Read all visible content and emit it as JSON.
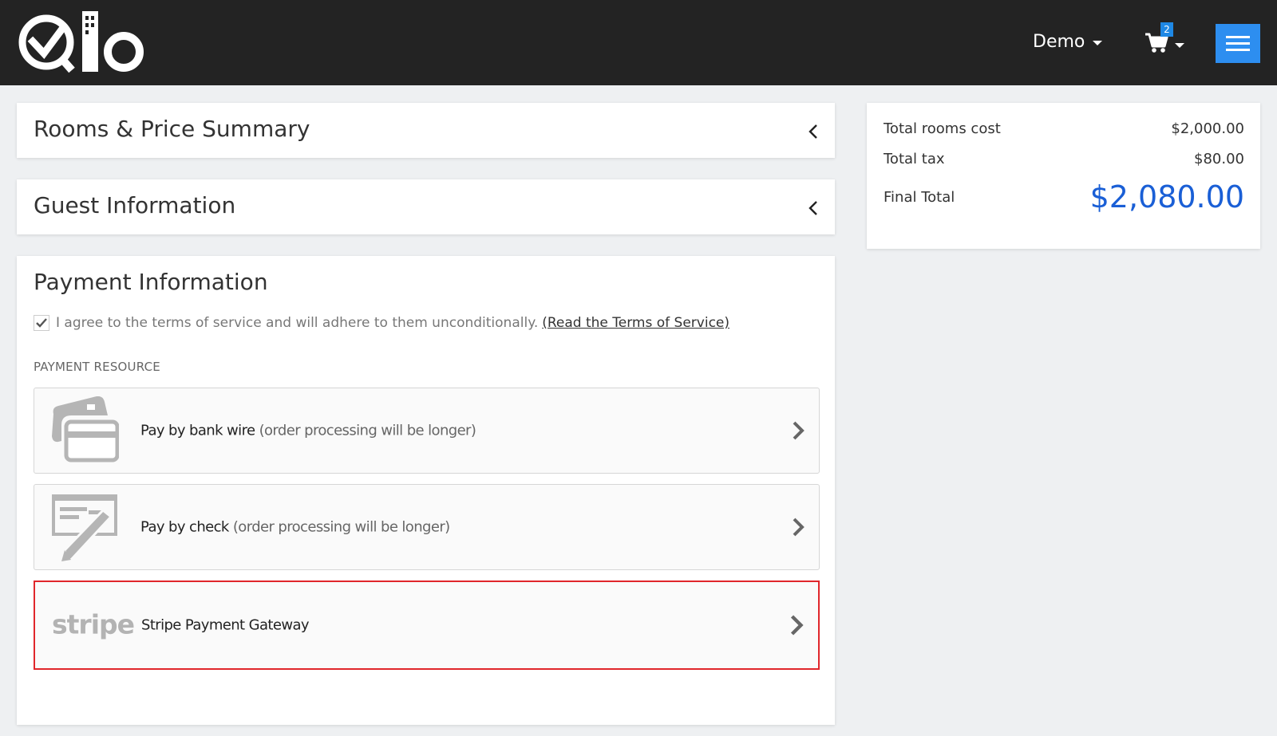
{
  "header": {
    "user_label": "Demo",
    "cart_count": "2",
    "brand_color": "#232323",
    "menu_color": "#2d8ef0"
  },
  "sections": {
    "rooms_title": "Rooms & Price Summary",
    "guest_title": "Guest Information",
    "payment_title": "Payment Information"
  },
  "payment": {
    "terms_text": "I agree to the terms of service and will adhere to them unconditionally.",
    "terms_link": "(Read the Terms of Service)",
    "terms_checked": true,
    "resource_label": "PAYMENT RESOURCE",
    "options": [
      {
        "name": "Pay by bank wire",
        "note": "(order processing will be longer)",
        "icon": "bank-wire-card-icon"
      },
      {
        "name": "Pay by check",
        "note": "(order processing will be longer)",
        "icon": "check-pen-icon"
      },
      {
        "name": "Stripe Payment Gateway",
        "note": "",
        "icon": "stripe-logo",
        "logo_text": "stripe",
        "selected": true
      }
    ]
  },
  "summary": {
    "rows": [
      {
        "label": "Total rooms cost",
        "value": "$2,000.00"
      },
      {
        "label": "Total tax",
        "value": "$80.00"
      },
      {
        "label": "Final Total",
        "value": "$2,080.00"
      }
    ],
    "final_color": "#1a5fd6"
  }
}
